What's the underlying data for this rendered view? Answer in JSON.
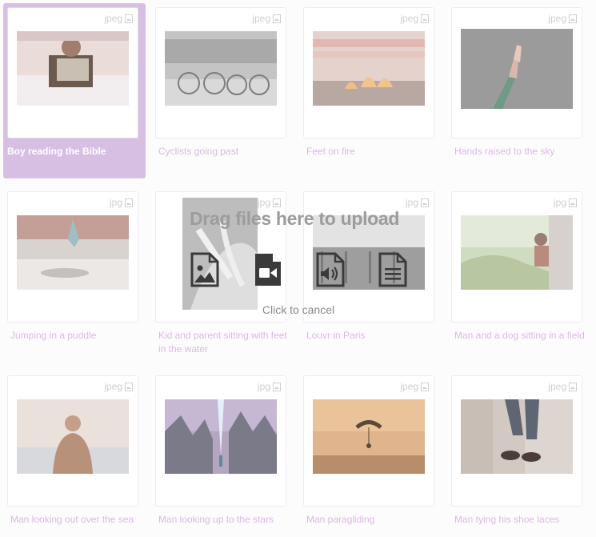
{
  "overlay": {
    "title": "Drag files here to upload",
    "cancel_label": "Click to cancel",
    "icons": [
      "image-file-icon",
      "video-file-icon",
      "audio-file-icon",
      "text-file-icon"
    ]
  },
  "colors": {
    "accent": "#d7bfe3",
    "caption": "#dcb7e3",
    "overlay_text": "#9c9c9c"
  },
  "items": [
    {
      "type": "jpeg",
      "caption": "Boy reading the Bible",
      "selected": true
    },
    {
      "type": "jpeg",
      "caption": "Cyclists going past"
    },
    {
      "type": "jpeg",
      "caption": "Feet on fire"
    },
    {
      "type": "jpeg",
      "caption": "Hands raised to the sky"
    },
    {
      "type": "jpg",
      "caption": "Jumping in a puddle"
    },
    {
      "type": "jpg",
      "caption": "Kid and parent sitting with feet in the water"
    },
    {
      "type": "jpg",
      "caption": "Louvr in Paris"
    },
    {
      "type": "jpg",
      "caption": "Man and a dog sitting in a field"
    },
    {
      "type": "jpeg",
      "caption": "Man looking out over the sea"
    },
    {
      "type": "jpg",
      "caption": "Man looking up to the stars"
    },
    {
      "type": "jpeg",
      "caption": "Man paragliding"
    },
    {
      "type": "jpeg",
      "caption": "Man tying his shoe laces"
    }
  ]
}
